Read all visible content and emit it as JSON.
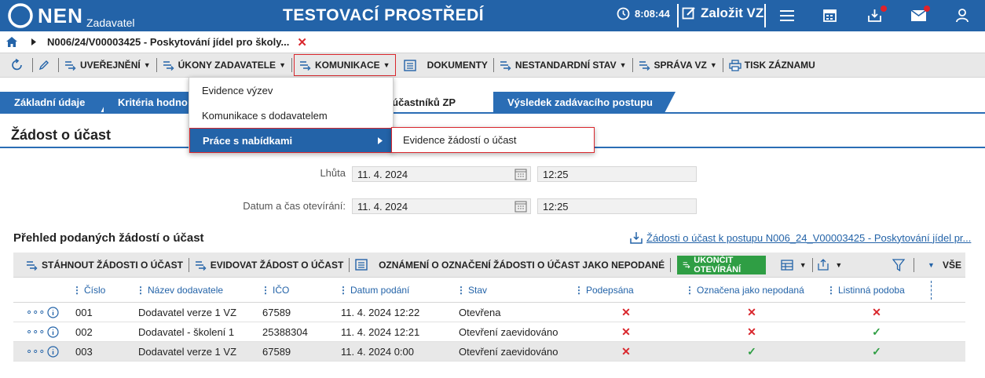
{
  "header": {
    "logo": "NEN",
    "logo_sub": "Zadavatel",
    "env_title": "TESTOVACÍ PROSTŘEDÍ",
    "timer": "8:08:44",
    "create_vz": "Založit VZ"
  },
  "breadcrumb": {
    "path": "N006/24/V00003425 - Poskytování jídel pro školy..."
  },
  "toolbar": {
    "publish": "UVEŘEJNĚNÍ",
    "acts": "ÚKONY ZADAVATELE",
    "communication": "KOMUNIKACE",
    "documents": "DOKUMENTY",
    "nonstandard": "NESTANDARDNÍ STAV",
    "vz_management": "SPRÁVA VZ",
    "print": "TISK ZÁZNAMU"
  },
  "tabs": [
    {
      "label": "Základní údaje"
    },
    {
      "label": "Kritéria hodno"
    },
    {
      "label": "ní účastníků ZP"
    },
    {
      "label": "Výsledek zadávacího postupu"
    }
  ],
  "dropdown": {
    "items": [
      {
        "label": "Evidence výzev"
      },
      {
        "label": "Komunikace s dodavatelem"
      },
      {
        "label": "Práce s nabídkami"
      }
    ],
    "submenu": "Evidence žádostí o účast"
  },
  "section": {
    "title": "Žádost o účast",
    "deadline_label": "Lhůta",
    "deadline_date": "11. 4. 2024",
    "deadline_time": "12:25",
    "opening_label": "Datum a čas otevírání:",
    "opening_date": "11. 4. 2024",
    "opening_time": "12:25"
  },
  "list": {
    "title": "Přehled podaných žádostí o účast",
    "link": "Žádosti o účast k postupu N006_24_V00003425 - Poskytování jídel pr..."
  },
  "grid_toolbar": {
    "download": "STÁHNOUT ŽÁDOSTI O ÚČAST",
    "register": "EVIDOVAT ŽÁDOST O ÚČAST",
    "notify": "OZNÁMENÍ O OZNAČENÍ ŽÁDOSTI O ÚČAST JAKO NEPODANÉ",
    "finish": "UKONČIT OTEVÍRÁNÍ",
    "all": "VŠE"
  },
  "table": {
    "columns": {
      "number": "Číslo",
      "supplier": "Název dodavatele",
      "ico": "IČO",
      "submitted": "Datum podání",
      "status": "Stav",
      "signed": "Podepsána",
      "marked": "Označena jako nepodaná",
      "paper": "Listinná podoba"
    },
    "rows": [
      {
        "number": "001",
        "supplier": "Dodavatel verze 1 VZ",
        "ico": "67589",
        "submitted": "11. 4. 2024 12:22",
        "status": "Otevřena",
        "signed": false,
        "marked": false,
        "paper": false
      },
      {
        "number": "002",
        "supplier": "Dodavatel - školení 1",
        "ico": "25388304",
        "submitted": "11. 4. 2024 12:21",
        "status": "Otevření zaevidováno",
        "signed": false,
        "marked": false,
        "paper": true
      },
      {
        "number": "003",
        "supplier": "Dodavatel verze 1 VZ",
        "ico": "67589",
        "submitted": "11. 4. 2024 0:00",
        "status": "Otevření zaevidováno",
        "signed": false,
        "marked": true,
        "paper": true
      }
    ]
  },
  "colors": {
    "primary": "#2363a8",
    "tab": "#2a6db5",
    "accent_red": "#d9262c",
    "green": "#2f9e44",
    "toolbar_bg": "#e8e8e8"
  }
}
